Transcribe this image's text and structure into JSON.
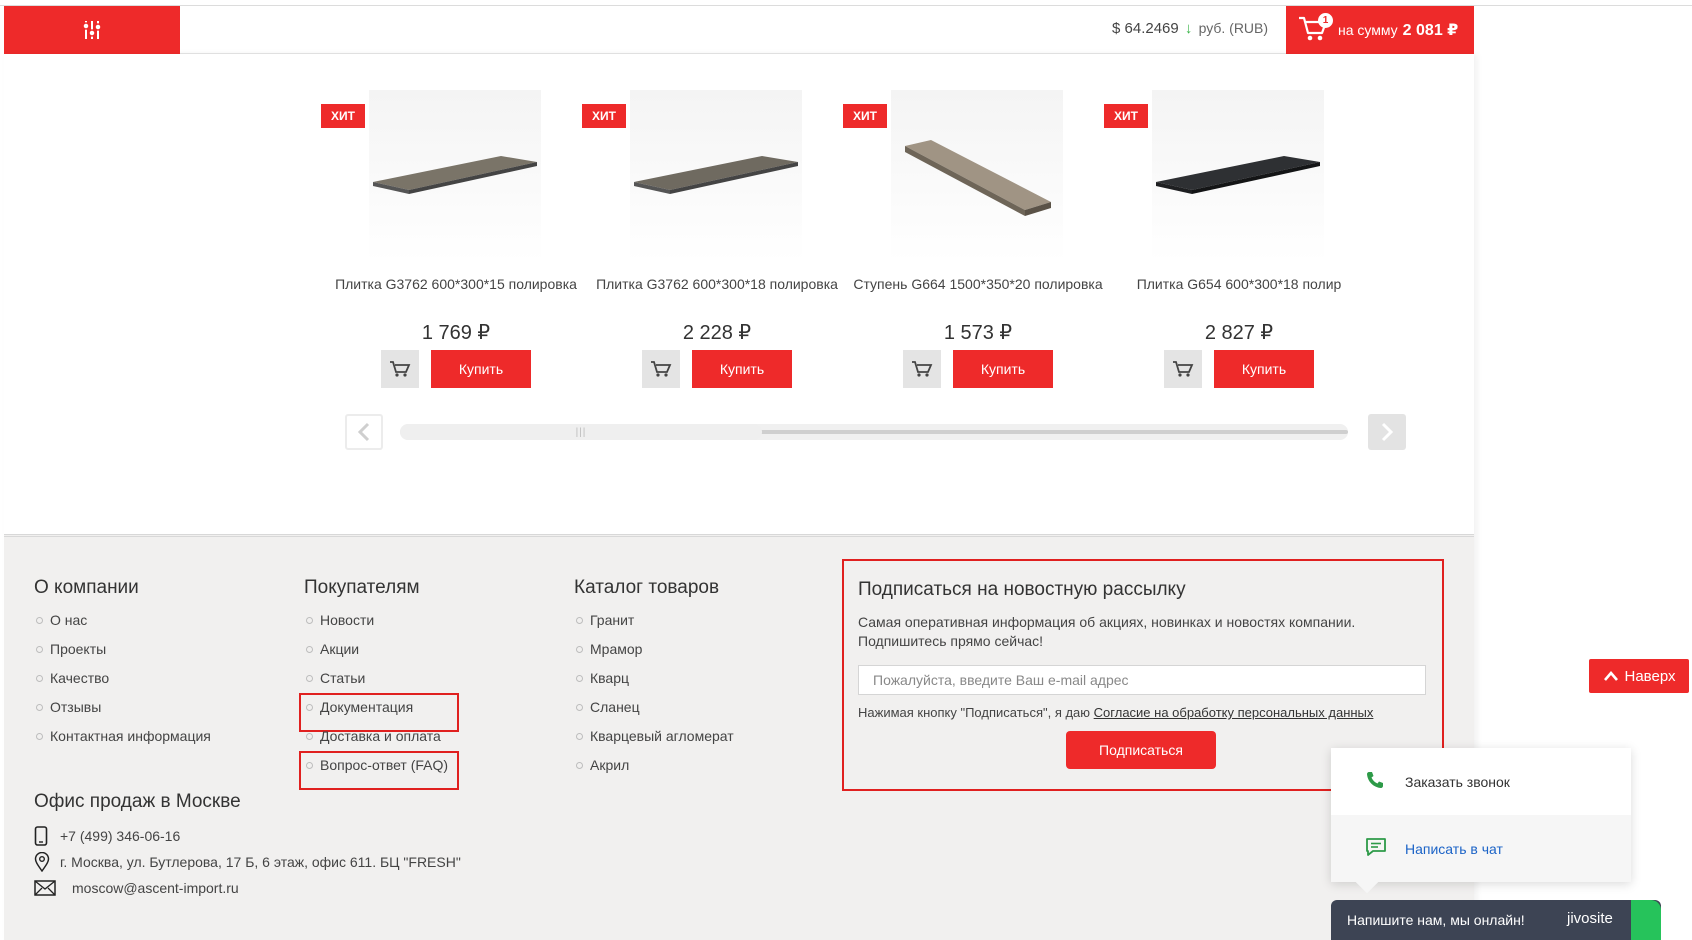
{
  "header": {
    "rate_value": "$ 64.2469",
    "rate_arrow": "↓",
    "rate_currency": "руб. (RUB)",
    "cart_count": "1",
    "cart_sum_label": "на сумму",
    "cart_sum": "2 081 ₽"
  },
  "products": [
    {
      "badge": "ХИТ",
      "name": "Плитка G3762 600*300*15 полировка",
      "price": "1 769 ₽",
      "buy": "Купить",
      "stone": "#7a7468"
    },
    {
      "badge": "ХИТ",
      "name": "Плитка G3762 600*300*18 полировка",
      "price": "2 228 ₽",
      "buy": "Купить",
      "stone": "#6f6a60"
    },
    {
      "badge": "ХИТ",
      "name": "Ступень G664 1500*350*20 полировка",
      "price": "1 573 ₽",
      "buy": "Купить",
      "stone": "#a09484"
    },
    {
      "badge": "ХИТ",
      "name": "Плитка G654 600*300*18 полир",
      "price": "2 827 ₽",
      "buy": "Купить",
      "stone": "#2e3033"
    }
  ],
  "footer": {
    "company": {
      "title": "О компании",
      "items": [
        "О нас",
        "Проекты",
        "Качество",
        "Отзывы",
        "Контактная информация"
      ]
    },
    "buyers": {
      "title": "Покупателям",
      "items": [
        "Новости",
        "Акции",
        "Статьи",
        "Документация",
        "Доставка и оплата",
        "Вопрос-ответ (FAQ)"
      ]
    },
    "catalog": {
      "title": "Каталог товаров",
      "items": [
        "Гранит",
        "Мрамор",
        "Кварц",
        "Сланец",
        "Кварцевый агломерат",
        "Акрил"
      ]
    },
    "subscribe": {
      "title": "Подписаться на новостную рассылку",
      "desc": "Самая оперативная информация об акциях, новинках и новостях компании. Подпишитесь прямо сейчас!",
      "placeholder": "Пожалуйста, введите Ваш e-mail адрес",
      "agree_text": "Нажимая кнопку \"Подписаться\", я даю ",
      "agree_link": "Согласие на обработку персональных данных",
      "button": "Подписаться"
    },
    "office": {
      "title": "Офис продаж в Москве",
      "phone": "+7 (499) 346-06-16",
      "address": "г. Москва, ул. Бутлерова, 17 Б, 6 этаж, офис 611. БЦ \"FRESH\"",
      "email": "moscow@ascent-import.ru"
    }
  },
  "widgets": {
    "to_top": "Наверх",
    "call": "Заказать звонок",
    "chat": "Написать в чат",
    "online": "Напишите нам, мы онлайн!",
    "brand": "jivosite"
  },
  "colors": {
    "accent": "#ee2a2a",
    "footer_bg": "#f1f0ef",
    "highlight": "#e0201f",
    "jivo_bar": "#3d4454"
  }
}
